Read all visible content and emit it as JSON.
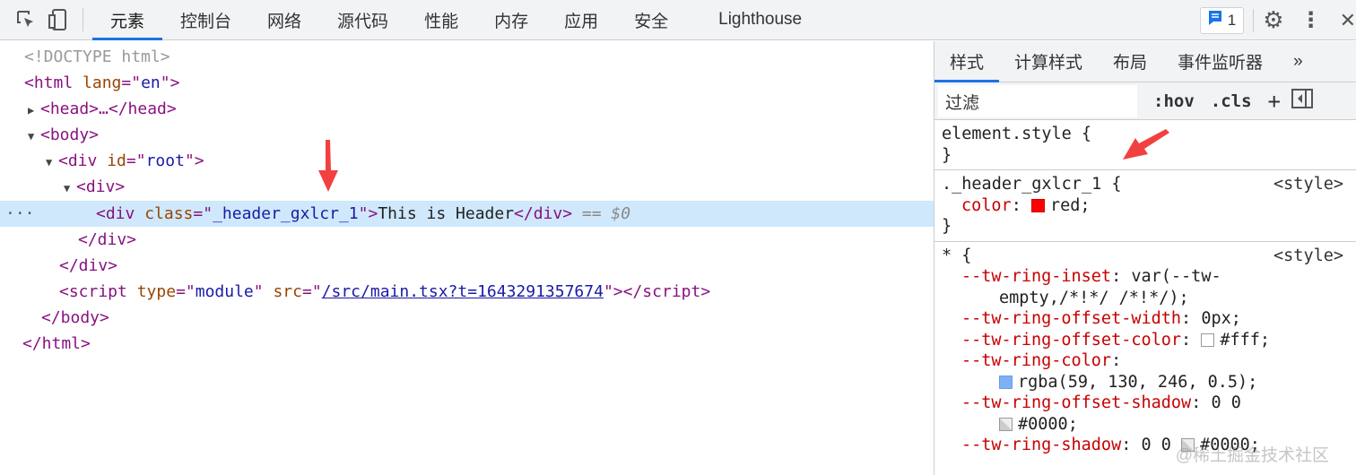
{
  "toolbar": {
    "tabs": [
      "元素",
      "控制台",
      "网络",
      "源代码",
      "性能",
      "内存",
      "应用",
      "安全",
      "Lighthouse"
    ],
    "active_tab": "元素",
    "issues_count": "1"
  },
  "dom": {
    "doctype": "<!DOCTYPE html>",
    "html_open": "<html",
    "lang_attr": "lang",
    "lang_val": "en",
    "head": "<head>…</head>",
    "body_open": "<body>",
    "div_open": "<div",
    "id_attr": "id",
    "id_val": "root",
    "div_plain": "<div>",
    "selected": {
      "open": "<div",
      "class_attr": "class",
      "class_val": "_header_gxlcr_1",
      "text": "This is Header",
      "close": "</div>",
      "marker": "== $0",
      "ellipsis": "···"
    },
    "div_close": "</div>",
    "script_open": "<script",
    "type_attr": "type",
    "type_val": "module",
    "src_attr": "src",
    "src_val": "/src/main.tsx?t=1643291357674",
    "script_close": "></script>",
    "body_close": "</body>",
    "html_close": "</html>"
  },
  "styles": {
    "tabs": [
      "样式",
      "计算样式",
      "布局",
      "事件监听器",
      "»"
    ],
    "filter_placeholder": "过滤",
    "hov": ":hov",
    "cls": ".cls",
    "plus": "+",
    "element_style": "element.style {",
    "close_brace": "}",
    "rule1": {
      "selector": "._header_gxlcr_1 {",
      "source": "<style>",
      "prop": "color",
      "value": "red;"
    },
    "rule2": {
      "selector": "* {",
      "source": "<style>",
      "decls": [
        {
          "prop": "--tw-ring-inset",
          "value": "var(--tw-",
          "cont": "empty,/*!*/ /*!*/);"
        },
        {
          "prop": "--tw-ring-offset-width",
          "value": "0px;"
        },
        {
          "prop": "--tw-ring-offset-color",
          "value": "#fff;"
        },
        {
          "prop": "--tw-ring-color",
          "cont": "rgba(59, 130, 246, 0.5);"
        },
        {
          "prop": "--tw-ring-offset-shadow",
          "value": "0 0",
          "cont": "#0000;"
        },
        {
          "prop": "--tw-ring-shadow",
          "value": "0 0",
          "cont": "#0000;"
        }
      ]
    }
  },
  "watermark": "@稀土掘金技术社区"
}
